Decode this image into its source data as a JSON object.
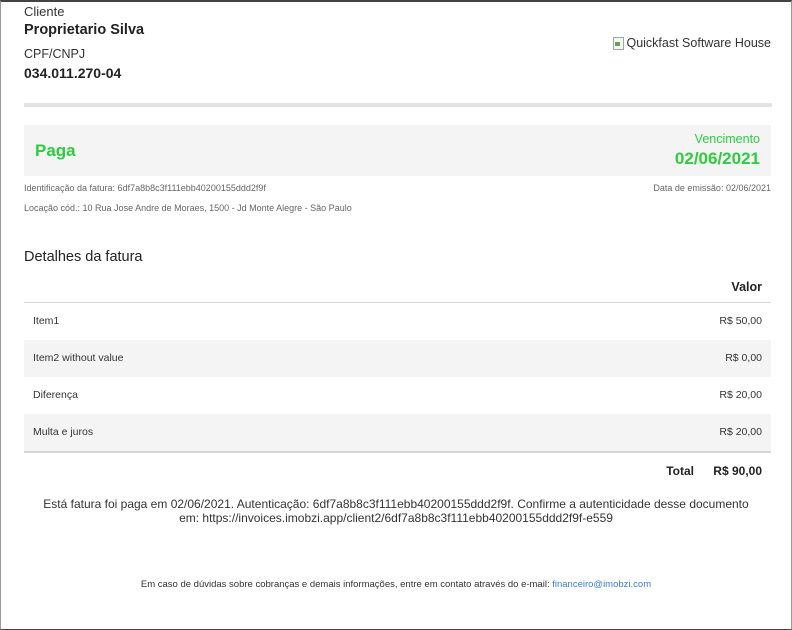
{
  "client": {
    "label": "Cliente",
    "name": "Proprietario Silva",
    "doc_label": "CPF/CNPJ",
    "doc_value": "034.011.270-04"
  },
  "logo": {
    "alt_text": "Quickfast Software House",
    "icon": "broken-image-icon"
  },
  "status": {
    "text": "Paga",
    "due_label": "Vencimento",
    "due_date": "02/06/2021",
    "color": "#2ecc40"
  },
  "meta": {
    "invoice_id": "Identificação da fatura: 6df7a8b8c3f111ebb40200155ddd2f9f",
    "issue_date": "Data de emissão: 02/06/2021",
    "location": "Locação cód.: 10 Rua Jose Andre de Moraes, 1500 - Jd Monte Alegre - São Paulo"
  },
  "details": {
    "title": "Detalhes da fatura",
    "value_header": "Valor",
    "items": [
      {
        "name": "Item1",
        "value": "R$ 50,00"
      },
      {
        "name": "Item2 without value",
        "value": "R$ 0,00"
      },
      {
        "name": "Diferença",
        "value": "R$ 20,00"
      },
      {
        "name": "Multa e juros",
        "value": "R$ 20,00"
      }
    ],
    "total_label": "Total",
    "total_value": "R$ 90,00"
  },
  "payment_note": {
    "line1": "Está fatura foi paga em 02/06/2021. Autenticação: 6df7a8b8c3f111ebb40200155ddd2f9f. Confirme a autenticidade desse documento",
    "line2": "em: https://invoices.imobzi.app/client2/6df7a8b8c3f111ebb40200155ddd2f9f-e559"
  },
  "footer": {
    "text": "Em caso de dúvidas sobre cobranças e demais informações, entre em contato através do e-mail:",
    "email": "financeiro@imobzi.com",
    "link_color": "#3b7dd8"
  }
}
